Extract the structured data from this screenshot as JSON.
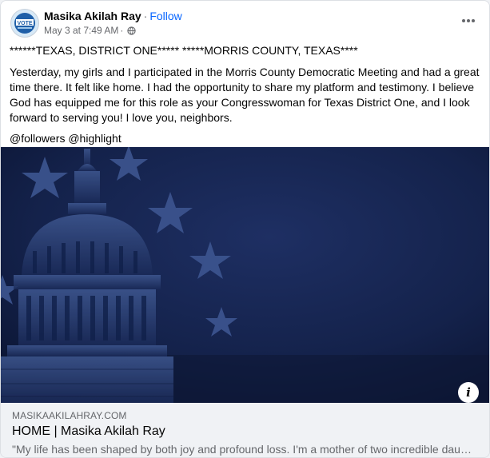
{
  "post": {
    "author": "Masika Akilah Ray",
    "separator": "·",
    "follow_label": "Follow",
    "timestamp": "May 3 at 7:49 AM",
    "meta_separator": "·",
    "privacy_icon": "globe-icon",
    "more_icon": "more-horizontal-icon",
    "avatar_text": "VOTE"
  },
  "text": {
    "headline": "******TEXAS, DISTRICT ONE***** *****MORRIS COUNTY, TEXAS****",
    "body": "Yesterday, my girls and I participated in the Morris County Democratic Meeting and had a great time there. It felt like home. I had the opportunity to share my platform and testimony. I believe God has equipped me for this role as your Congresswoman for Texas District One, and I look forward to serving you! I love you, neighbors.",
    "tags": "@followers @highlight"
  },
  "image": {
    "description_icon": "capitol-dome-stars-image",
    "info_label": "i"
  },
  "link": {
    "domain": "MASIKAAKILAHRAY.COM",
    "title": "HOME | Masika Akilah Ray",
    "description": "\"My life has been shaped by both joy and profound loss. I'm a mother of two incredible daughters..."
  },
  "colors": {
    "follow": "#0866ff",
    "meta": "#65676b",
    "image_bg": "#0f1a3a"
  }
}
